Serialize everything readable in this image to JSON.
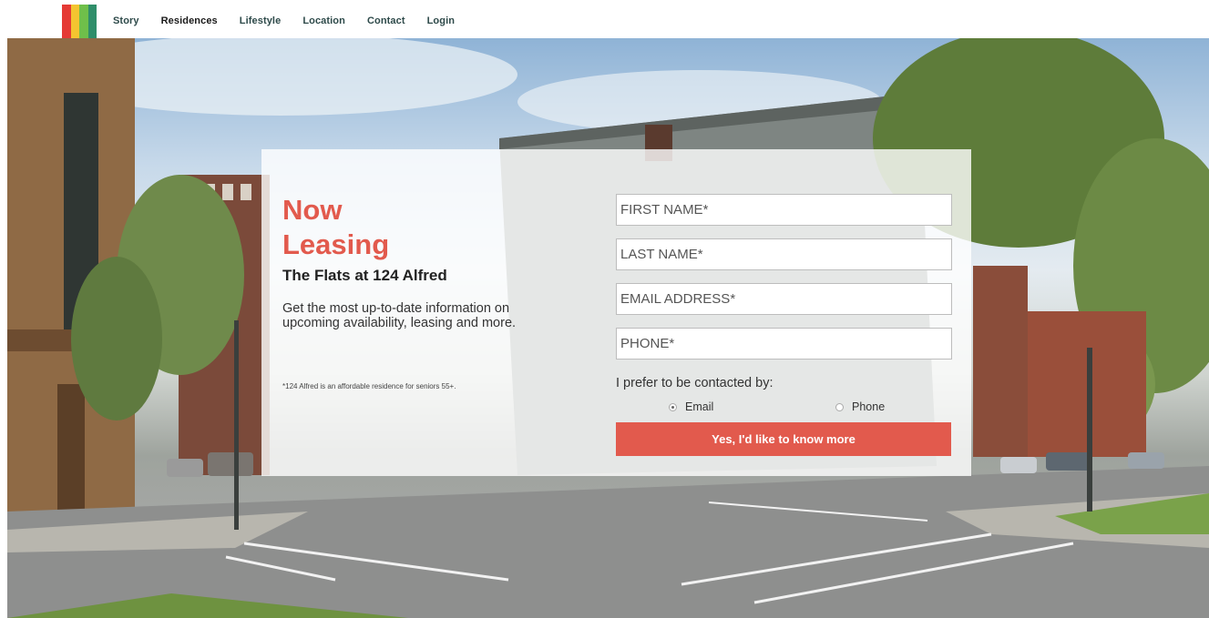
{
  "brand": {
    "logo_stripes": [
      "#e53a35",
      "#f4c430",
      "#6fbf4a",
      "#2f8e6a"
    ]
  },
  "nav": {
    "items": [
      {
        "label": "Story",
        "active": false
      },
      {
        "label": "Residences",
        "active": true
      },
      {
        "label": "Lifestyle",
        "active": false
      },
      {
        "label": "Location",
        "active": false
      },
      {
        "label": "Contact",
        "active": false
      },
      {
        "label": "Login",
        "active": false
      }
    ]
  },
  "hero": {
    "headline_line1": "Now",
    "headline_line2": "Leasing",
    "headline_color": "#e25a4d",
    "subhead": "The Flats at 124 Alfred",
    "description": "Get the most up-to-date information on upcoming availability, leasing and more.",
    "footnote": "*124 Alfred is an affordable residence for seniors 55+."
  },
  "form": {
    "first_name_placeholder": "FIRST NAME*",
    "last_name_placeholder": "LAST NAME*",
    "email_placeholder": "EMAIL ADDRESS*",
    "phone_placeholder": "PHONE*",
    "contact_pref_label": "I prefer to be contacted by:",
    "options": [
      {
        "label": "Email",
        "selected": true
      },
      {
        "label": "Phone",
        "selected": false
      }
    ],
    "submit_label": "Yes, I'd like to know more",
    "submit_color": "#e25a4d"
  }
}
